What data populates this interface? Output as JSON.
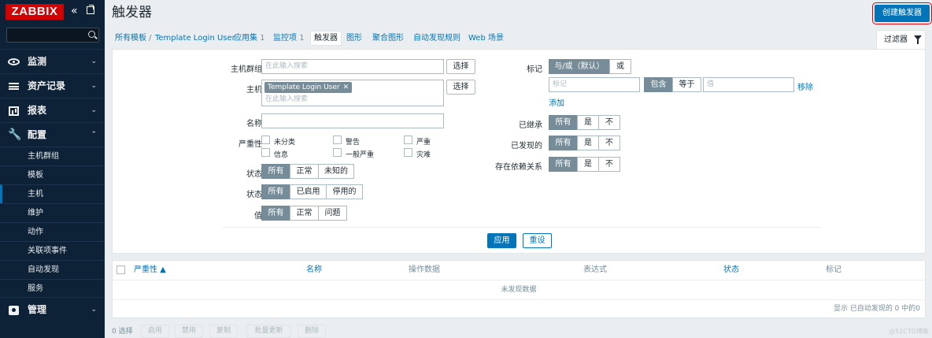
{
  "app": {
    "logo": "ZABBIX"
  },
  "sidebar": {
    "menu": [
      {
        "label": "监测",
        "icon": "eye-icon"
      },
      {
        "label": "资产记录",
        "icon": "list-icon"
      },
      {
        "label": "报表",
        "icon": "bar-chart-icon"
      },
      {
        "label": "配置",
        "icon": "wrench-icon"
      },
      {
        "label": "管理",
        "icon": "gear-icon"
      }
    ],
    "config_items": [
      "主机群组",
      "模板",
      "主机",
      "维护",
      "动作",
      "关联项事件",
      "自动发现",
      "服务"
    ],
    "active_sub": "主机"
  },
  "header": {
    "title": "触发器",
    "create_button": "创建触发器"
  },
  "breadcrumb": {
    "all_templates": "所有模板",
    "separator": "/",
    "template": "Template Login User",
    "apps": "应用集",
    "apps_count": "1",
    "items": "监控项",
    "items_count": "1",
    "triggers": "触发器",
    "graphs": "图形",
    "screens": "聚合图形",
    "discovery": "自动发现规则",
    "web": "Web 场景"
  },
  "filter": {
    "tab_label": "过滤器",
    "host_group_label": "主机群组",
    "host_group_placeholder": "在此输入搜索",
    "select_label": "选择",
    "host_label": "主机",
    "host_chip": "Template Login User",
    "host_placeholder": "在此输入搜索",
    "name_label": "名称",
    "severity_label": "严重性",
    "severities": [
      "未分类",
      "警告",
      "严重",
      "信息",
      "一般严重",
      "灾难"
    ],
    "state_label": "状态",
    "state_options": [
      "所有",
      "正常",
      "未知的"
    ],
    "status_label": "状态",
    "status_options": [
      "所有",
      "已启用",
      "停用的"
    ],
    "value_label": "值",
    "value_options": [
      "所有",
      "正常",
      "问题"
    ],
    "tags_label": "标记",
    "tags_mode": [
      "与/或（默认）",
      "或"
    ],
    "tag_placeholder": "标记",
    "tag_ops": [
      "包含",
      "等于"
    ],
    "tag_value_placeholder": "值",
    "remove_link": "移除",
    "add_link": "添加",
    "inherited_label": "已继承",
    "discovered_label": "已发现的",
    "dependencies_label": "存在依赖关系",
    "tri_options": [
      "所有",
      "是",
      "不"
    ],
    "apply": "应用",
    "reset": "重设"
  },
  "table": {
    "columns": [
      "严重性 ▲",
      "名称",
      "操作数据",
      "表达式",
      "状态",
      "标记"
    ],
    "no_data": "未发现数据",
    "footer": "显示 已自动发现的 0 中的0"
  },
  "actions": {
    "selected": "0 选择",
    "buttons": [
      "启用",
      "禁用",
      "复制",
      "批量更新",
      "删除"
    ]
  },
  "watermark": "@51CTO博客"
}
